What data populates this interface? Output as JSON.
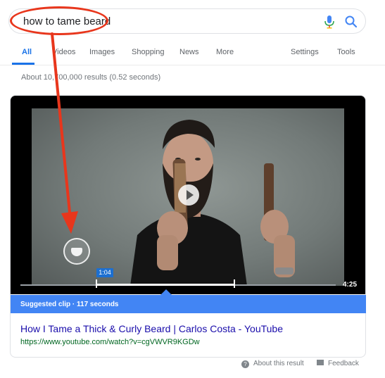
{
  "search": {
    "query": "how to tame beard"
  },
  "tabs": [
    {
      "label": "All",
      "active": true
    },
    {
      "label": "Videos"
    },
    {
      "label": "Images"
    },
    {
      "label": "Shopping"
    },
    {
      "label": "News"
    },
    {
      "label": "More"
    },
    {
      "label": "Settings"
    },
    {
      "label": "Tools"
    }
  ],
  "stats": "About 10,700,000 results (0.52 seconds)",
  "video": {
    "current_time": "1:04",
    "duration": "4:25",
    "suggested_clip": "Suggested clip · 117 seconds"
  },
  "result": {
    "title": "How I Tame a Thick & Curly Beard | Carlos Costa - YouTube",
    "url": "https://www.youtube.com/watch?v=cgVWVR9KGDw"
  },
  "footer": {
    "about": "About this result",
    "feedback": "Feedback"
  },
  "colors": {
    "accent": "#1a73e8",
    "highlight": "#e8361c",
    "clip_bar": "#4285f4",
    "link": "#1a0dab",
    "url": "#006621"
  }
}
